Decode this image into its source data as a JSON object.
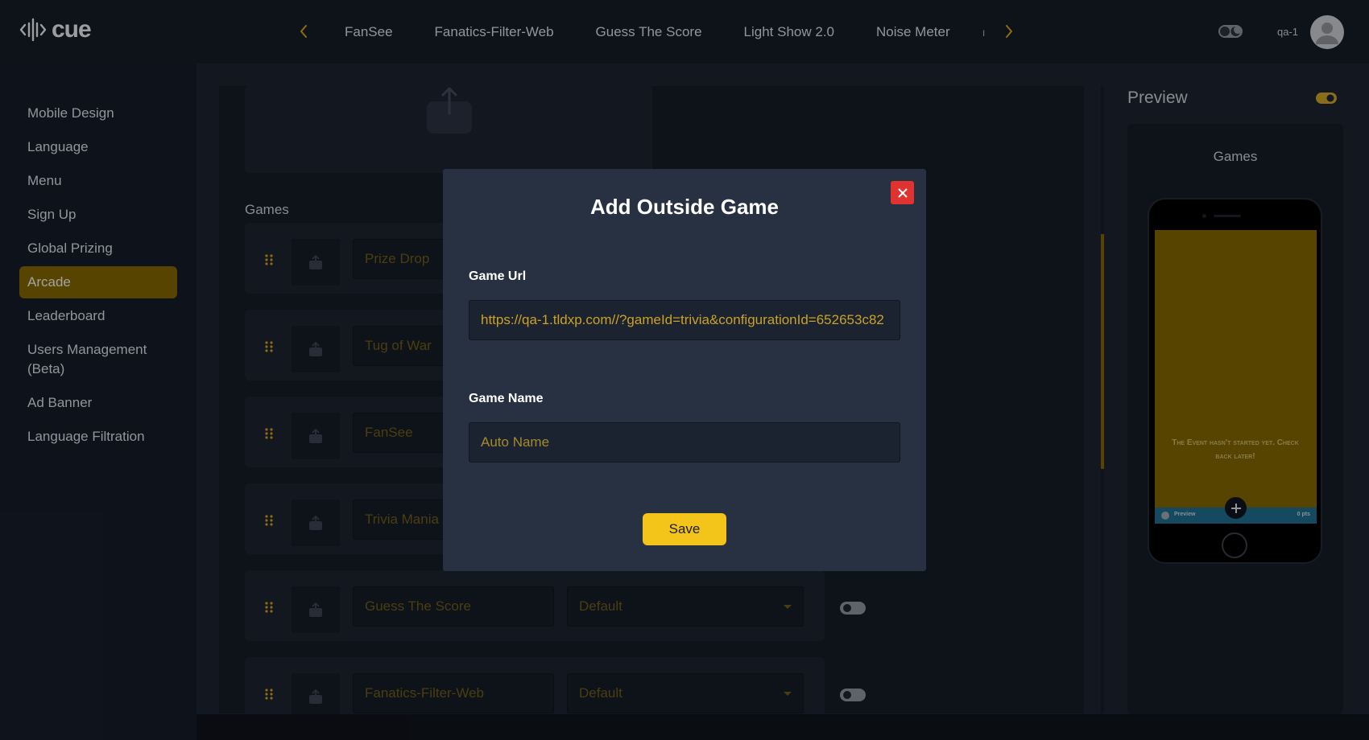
{
  "app": {
    "brand": "cue",
    "user": "qa-1"
  },
  "tabs": [
    "FanSee",
    "Fanatics-Filter-Web",
    "Guess The Score",
    "Light Show 2.0",
    "Noise Meter"
  ],
  "sidebar": {
    "items": [
      {
        "label": "Mobile Design"
      },
      {
        "label": "Language"
      },
      {
        "label": "Menu"
      },
      {
        "label": "Sign Up"
      },
      {
        "label": "Global Prizing"
      },
      {
        "label": "Arcade",
        "active": true
      },
      {
        "label": "Leaderboard"
      },
      {
        "label": "Users Management (Beta)"
      },
      {
        "label": "Ad Banner"
      },
      {
        "label": "Language Filtration"
      }
    ]
  },
  "editor": {
    "games_label": "Games",
    "rows": [
      {
        "name": "Prize Drop",
        "type": ""
      },
      {
        "name": "Tug of War",
        "type": ""
      },
      {
        "name": "FanSee",
        "type": ""
      },
      {
        "name": "Trivia Mania",
        "type": ""
      },
      {
        "name": "Guess The Score",
        "type": "Default"
      },
      {
        "name": "Fanatics-Filter-Web",
        "type": "Default"
      }
    ]
  },
  "preview": {
    "title": "Preview",
    "section": "Games",
    "message": "The Event hasn't started yet. Check back later!",
    "bar_left": "Preview",
    "bar_right": "0 pts"
  },
  "modal": {
    "title": "Add Outside Game",
    "url_label": "Game Url",
    "url_value": "https://qa-1.tldxp.com//?gameId=trivia&configurationId=652653c82",
    "name_label": "Game Name",
    "name_placeholder": "Auto Name",
    "save_label": "Save"
  },
  "colors": {
    "accent": "#f3c41a",
    "active_bg": "#806500",
    "danger": "#e0322f",
    "bg": "#1b2230"
  },
  "icons": [
    "cue-logo-icon",
    "chevron-left-icon",
    "chevron-right-icon",
    "theme-toggle-icon",
    "user-avatar-icon",
    "upload-icon",
    "drag-handle-icon",
    "toggle-icon",
    "close-icon",
    "plus-icon"
  ]
}
